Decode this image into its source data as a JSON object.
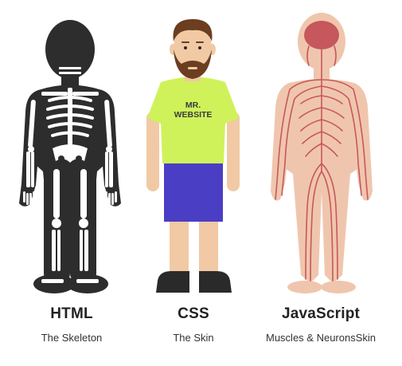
{
  "figures": [
    {
      "title": "HTML",
      "subtitle": "The Skeleton"
    },
    {
      "title": "CSS",
      "subtitle": "The Skin",
      "shirt_text": [
        "MR.",
        "WEBSITE"
      ]
    },
    {
      "title": "JavaScript",
      "subtitle": "Muscles & NeuronsSkin"
    }
  ],
  "colors": {
    "skeleton_dark": "#2d2d2d",
    "bone_white": "#ffffff",
    "skin": "#f1c9a5",
    "hair_beard": "#6b3e1f",
    "shirt": "#cff25b",
    "shorts": "#4a3fc4",
    "shoes": "#2a2a2a",
    "anatomy_body": "#efc6ad",
    "anatomy_lines": "#c9575c",
    "brain": "#c6575c"
  }
}
